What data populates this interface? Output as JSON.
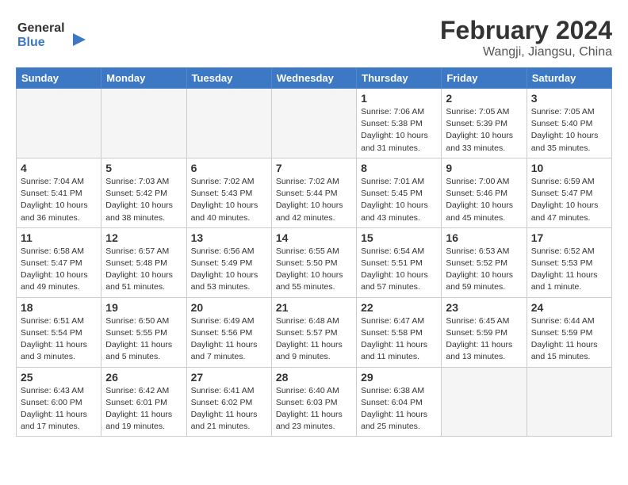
{
  "logo": {
    "line1": "General",
    "line2": "Blue"
  },
  "title": "February 2024",
  "subtitle": "Wangji, Jiangsu, China",
  "days_of_week": [
    "Sunday",
    "Monday",
    "Tuesday",
    "Wednesday",
    "Thursday",
    "Friday",
    "Saturday"
  ],
  "weeks": [
    [
      {
        "day": "",
        "info": ""
      },
      {
        "day": "",
        "info": ""
      },
      {
        "day": "",
        "info": ""
      },
      {
        "day": "",
        "info": ""
      },
      {
        "day": "1",
        "info": "Sunrise: 7:06 AM\nSunset: 5:38 PM\nDaylight: 10 hours and 31 minutes."
      },
      {
        "day": "2",
        "info": "Sunrise: 7:05 AM\nSunset: 5:39 PM\nDaylight: 10 hours and 33 minutes."
      },
      {
        "day": "3",
        "info": "Sunrise: 7:05 AM\nSunset: 5:40 PM\nDaylight: 10 hours and 35 minutes."
      }
    ],
    [
      {
        "day": "4",
        "info": "Sunrise: 7:04 AM\nSunset: 5:41 PM\nDaylight: 10 hours and 36 minutes."
      },
      {
        "day": "5",
        "info": "Sunrise: 7:03 AM\nSunset: 5:42 PM\nDaylight: 10 hours and 38 minutes."
      },
      {
        "day": "6",
        "info": "Sunrise: 7:02 AM\nSunset: 5:43 PM\nDaylight: 10 hours and 40 minutes."
      },
      {
        "day": "7",
        "info": "Sunrise: 7:02 AM\nSunset: 5:44 PM\nDaylight: 10 hours and 42 minutes."
      },
      {
        "day": "8",
        "info": "Sunrise: 7:01 AM\nSunset: 5:45 PM\nDaylight: 10 hours and 43 minutes."
      },
      {
        "day": "9",
        "info": "Sunrise: 7:00 AM\nSunset: 5:46 PM\nDaylight: 10 hours and 45 minutes."
      },
      {
        "day": "10",
        "info": "Sunrise: 6:59 AM\nSunset: 5:47 PM\nDaylight: 10 hours and 47 minutes."
      }
    ],
    [
      {
        "day": "11",
        "info": "Sunrise: 6:58 AM\nSunset: 5:47 PM\nDaylight: 10 hours and 49 minutes."
      },
      {
        "day": "12",
        "info": "Sunrise: 6:57 AM\nSunset: 5:48 PM\nDaylight: 10 hours and 51 minutes."
      },
      {
        "day": "13",
        "info": "Sunrise: 6:56 AM\nSunset: 5:49 PM\nDaylight: 10 hours and 53 minutes."
      },
      {
        "day": "14",
        "info": "Sunrise: 6:55 AM\nSunset: 5:50 PM\nDaylight: 10 hours and 55 minutes."
      },
      {
        "day": "15",
        "info": "Sunrise: 6:54 AM\nSunset: 5:51 PM\nDaylight: 10 hours and 57 minutes."
      },
      {
        "day": "16",
        "info": "Sunrise: 6:53 AM\nSunset: 5:52 PM\nDaylight: 10 hours and 59 minutes."
      },
      {
        "day": "17",
        "info": "Sunrise: 6:52 AM\nSunset: 5:53 PM\nDaylight: 11 hours and 1 minute."
      }
    ],
    [
      {
        "day": "18",
        "info": "Sunrise: 6:51 AM\nSunset: 5:54 PM\nDaylight: 11 hours and 3 minutes."
      },
      {
        "day": "19",
        "info": "Sunrise: 6:50 AM\nSunset: 5:55 PM\nDaylight: 11 hours and 5 minutes."
      },
      {
        "day": "20",
        "info": "Sunrise: 6:49 AM\nSunset: 5:56 PM\nDaylight: 11 hours and 7 minutes."
      },
      {
        "day": "21",
        "info": "Sunrise: 6:48 AM\nSunset: 5:57 PM\nDaylight: 11 hours and 9 minutes."
      },
      {
        "day": "22",
        "info": "Sunrise: 6:47 AM\nSunset: 5:58 PM\nDaylight: 11 hours and 11 minutes."
      },
      {
        "day": "23",
        "info": "Sunrise: 6:45 AM\nSunset: 5:59 PM\nDaylight: 11 hours and 13 minutes."
      },
      {
        "day": "24",
        "info": "Sunrise: 6:44 AM\nSunset: 5:59 PM\nDaylight: 11 hours and 15 minutes."
      }
    ],
    [
      {
        "day": "25",
        "info": "Sunrise: 6:43 AM\nSunset: 6:00 PM\nDaylight: 11 hours and 17 minutes."
      },
      {
        "day": "26",
        "info": "Sunrise: 6:42 AM\nSunset: 6:01 PM\nDaylight: 11 hours and 19 minutes."
      },
      {
        "day": "27",
        "info": "Sunrise: 6:41 AM\nSunset: 6:02 PM\nDaylight: 11 hours and 21 minutes."
      },
      {
        "day": "28",
        "info": "Sunrise: 6:40 AM\nSunset: 6:03 PM\nDaylight: 11 hours and 23 minutes."
      },
      {
        "day": "29",
        "info": "Sunrise: 6:38 AM\nSunset: 6:04 PM\nDaylight: 11 hours and 25 minutes."
      },
      {
        "day": "",
        "info": ""
      },
      {
        "day": "",
        "info": ""
      }
    ]
  ]
}
